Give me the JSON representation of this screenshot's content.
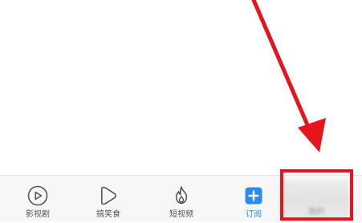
{
  "tab_bar": {
    "tabs": [
      {
        "label": "影视剧",
        "icon": "play-circle-icon",
        "active": false
      },
      {
        "label": "搞笑食",
        "icon": "play-bubble-icon",
        "active": false
      },
      {
        "label": "短视频",
        "icon": "flame-icon",
        "active": false
      },
      {
        "label": "订阅",
        "icon": "plus-square-icon",
        "active": true
      }
    ],
    "hidden_tab_label": "我的"
  },
  "colors": {
    "accent": "#2a8cf0",
    "annotation_red": "#e6151c",
    "tab_bar_bg": "#f7f7f7",
    "icon_gray": "#555555"
  },
  "annotation": {
    "type": "red-arrow-and-box",
    "target": "hidden_tab"
  }
}
